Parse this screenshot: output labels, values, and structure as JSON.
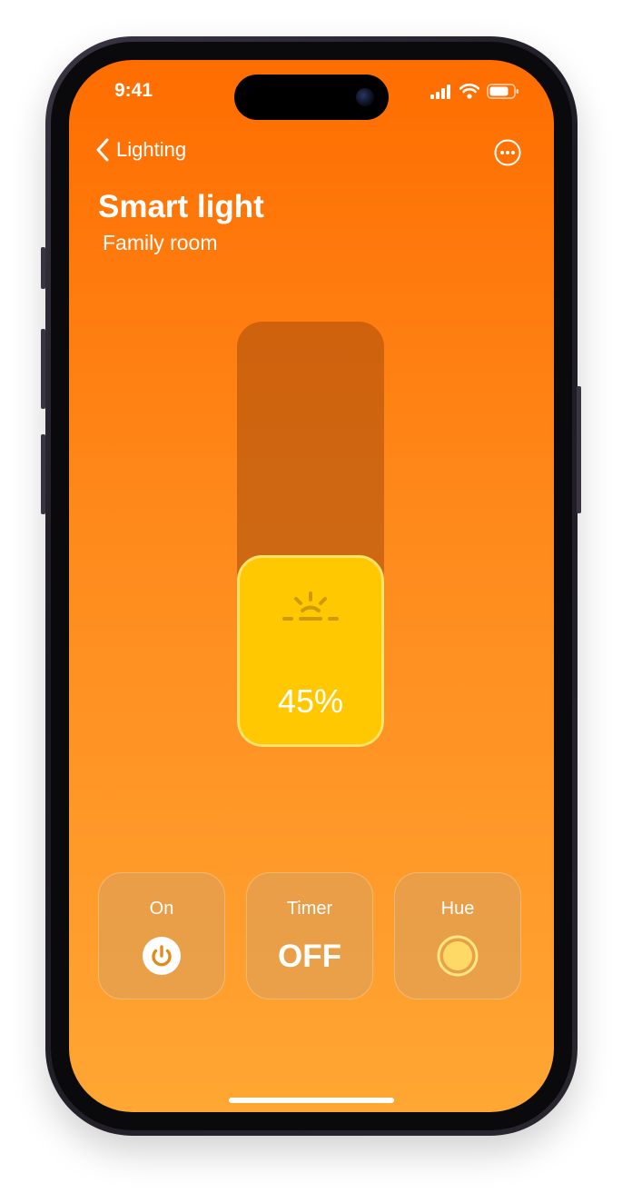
{
  "status_bar": {
    "time": "9:41",
    "icons": [
      "signal-icon",
      "wifi-icon",
      "battery-icon"
    ]
  },
  "nav": {
    "back_label": "Lighting",
    "back_icon": "chevron-left-icon",
    "more_icon": "ellipsis-circle-icon"
  },
  "header": {
    "title": "Smart light",
    "subtitle": "Family room"
  },
  "brightness": {
    "level_fraction": 0.45,
    "value_text": "45%",
    "icon": "sun-rising-icon"
  },
  "controls": {
    "power": {
      "label": "On",
      "icon": "power-icon"
    },
    "timer": {
      "label": "Timer",
      "value": "OFF"
    },
    "hue": {
      "label": "Hue",
      "icon": "color-swatch-icon",
      "color": "#ffd966"
    }
  },
  "colors": {
    "background_top": "#ff6d00",
    "background_bottom": "#ffa633",
    "slider_fill": "#ffc800"
  }
}
